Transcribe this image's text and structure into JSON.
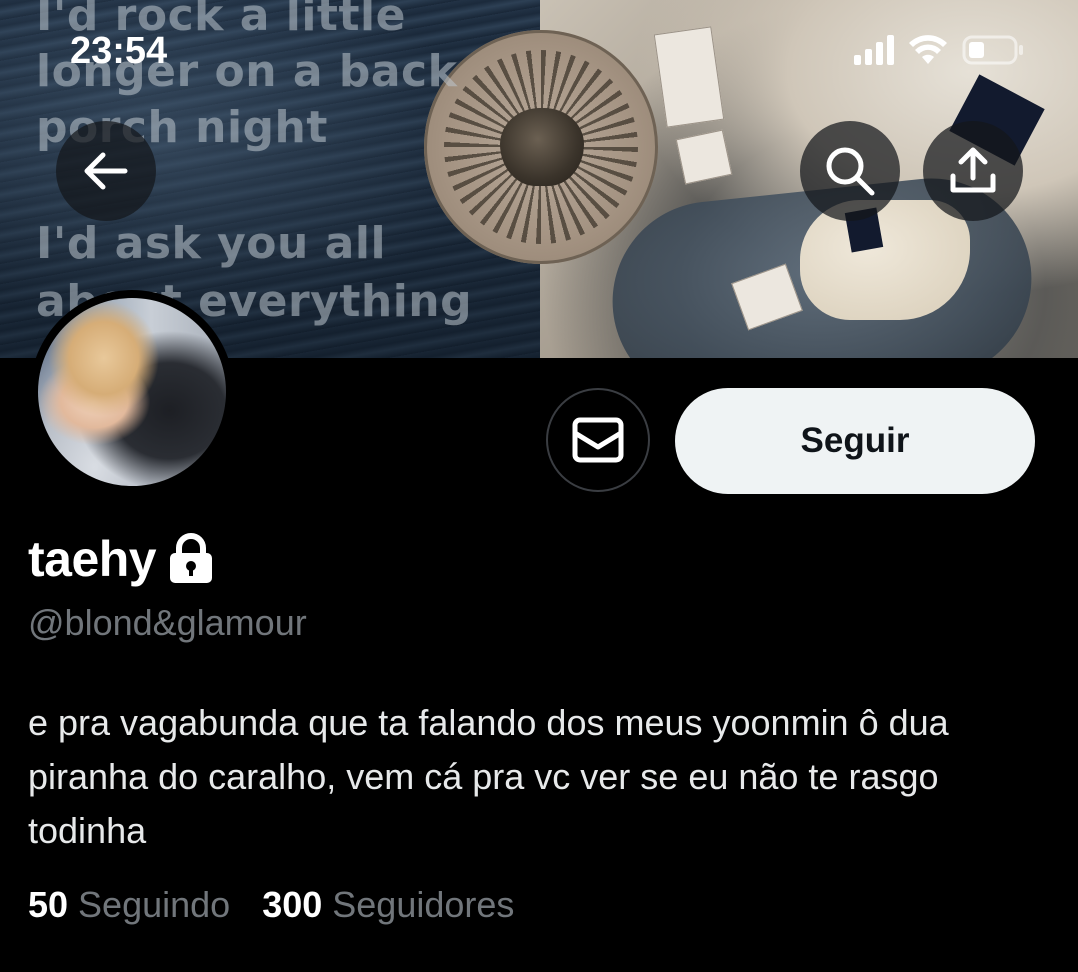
{
  "status_bar": {
    "time": "23:54"
  },
  "banner": {
    "lyrics": [
      "I'd rock a little",
      "longer on a back",
      "porch night",
      "I'd ask you all",
      "about everything"
    ]
  },
  "header": {
    "back_icon": "arrow-left-icon",
    "search_icon": "search-icon",
    "share_icon": "share-upload-icon"
  },
  "actions": {
    "message_icon": "envelope-icon",
    "follow_label": "Seguir"
  },
  "profile": {
    "display_name": "taehy",
    "protected_icon": "lock-icon",
    "handle": "@blond&glamour",
    "bio": "e pra vagabunda que ta falando dos meus yoonmin ô dua piranha do caralho, vem cá pra vc ver se eu não te rasgo todinha"
  },
  "stats": {
    "following_count": "50",
    "following_label": "Seguindo",
    "followers_count": "300",
    "followers_label": "Seguidores"
  },
  "colors": {
    "background": "#000000",
    "primary_text": "#e7e9ea",
    "secondary_text": "#71767b",
    "follow_button_bg": "#eff3f4",
    "follow_button_text": "#0f1419"
  }
}
